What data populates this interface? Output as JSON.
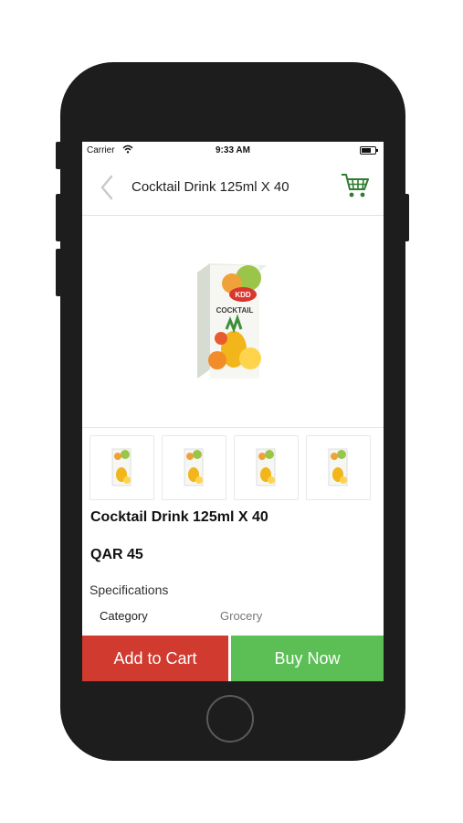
{
  "status_bar": {
    "carrier": "Carrier",
    "time": "9:33 AM",
    "battery_level": 0.7
  },
  "header": {
    "title": "Cocktail Drink 125ml X 40",
    "back_icon": "chevron-left-icon",
    "cart_icon": "shopping-cart-icon"
  },
  "product": {
    "name": "Cocktail Drink 125ml X 40",
    "price": "QAR 45",
    "image": {
      "brand": "KDD",
      "label": "COCKTAIL"
    },
    "thumbnail_count": 4
  },
  "specifications": {
    "title": "Specifications",
    "rows": [
      {
        "key": "Category",
        "value": "Grocery"
      }
    ]
  },
  "actions": {
    "add_to_cart": "Add to Cart",
    "buy_now": "Buy Now"
  },
  "colors": {
    "add_to_cart": "#d03a2f",
    "buy_now": "#5cbf56",
    "cart_icon": "#2e7d32",
    "device": "#1d1d1d"
  }
}
